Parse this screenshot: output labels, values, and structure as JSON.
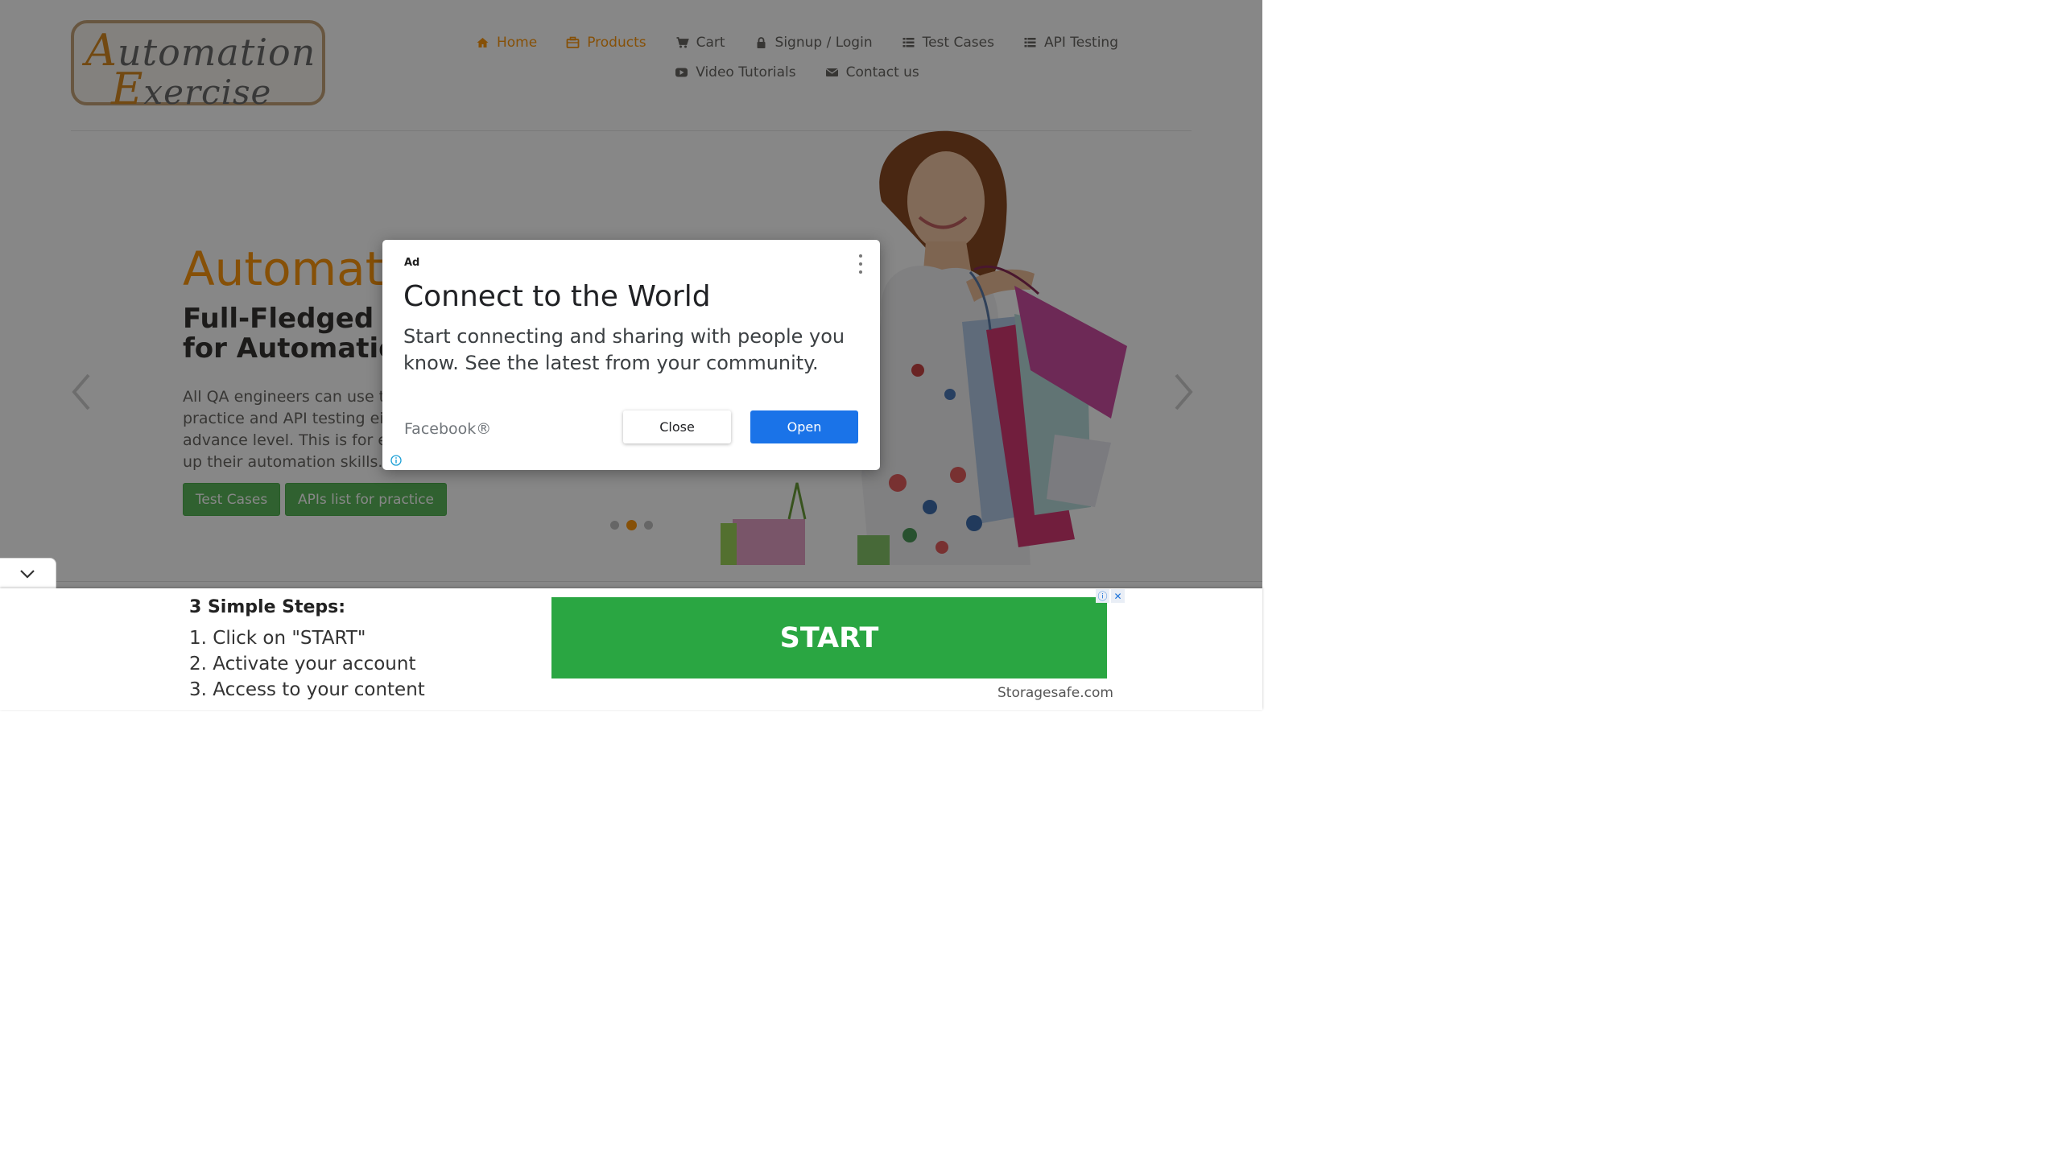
{
  "logo": {
    "line1_cap": "A",
    "line1_rest": "utomation",
    "line2_cap": "E",
    "line2_rest": "xercise"
  },
  "nav": {
    "row1": [
      {
        "label": "Home",
        "icon": "home-icon",
        "active": true
      },
      {
        "label": "Products",
        "icon": "briefcase-icon",
        "active": true
      },
      {
        "label": "Cart",
        "icon": "cart-icon"
      },
      {
        "label": "Signup / Login",
        "icon": "lock-icon"
      },
      {
        "label": "Test Cases",
        "icon": "list-icon"
      },
      {
        "label": "API Testing",
        "icon": "list-icon"
      }
    ],
    "row2": [
      {
        "label": "Video Tutorials",
        "icon": "youtube-play-icon"
      },
      {
        "label": "Contact us",
        "icon": "envelope-icon"
      }
    ]
  },
  "hero": {
    "title": "AutomationExercise",
    "subtitle": "Full-Fledged practice website for Automation Engineers",
    "description": "All QA engineers can use this website for automation practice and API testing either they are at beginner or advance level. This is for everybody to help them brush up their automation skills.",
    "buttons": [
      "Test Cases",
      "APIs list for practice"
    ],
    "carousel_active_index": 1,
    "carousel_count": 3
  },
  "modal": {
    "ad_label": "Ad",
    "title": "Connect to the World",
    "body": "Start connecting and sharing with people you know. See the latest from your community.",
    "brand": "Facebook®",
    "close_label": "Close",
    "open_label": "Open"
  },
  "bottom_ad": {
    "title": "3 Simple Steps:",
    "steps": [
      "1. Click on \"START\"",
      "2. Activate your account",
      "3. Access to your content"
    ],
    "cta": "START",
    "source": "Storagesafe.com"
  },
  "colors": {
    "accent": "#fe980f",
    "success": "#5cb85c",
    "ad_green": "#2aa642",
    "ad_blue": "#1a73e8"
  }
}
